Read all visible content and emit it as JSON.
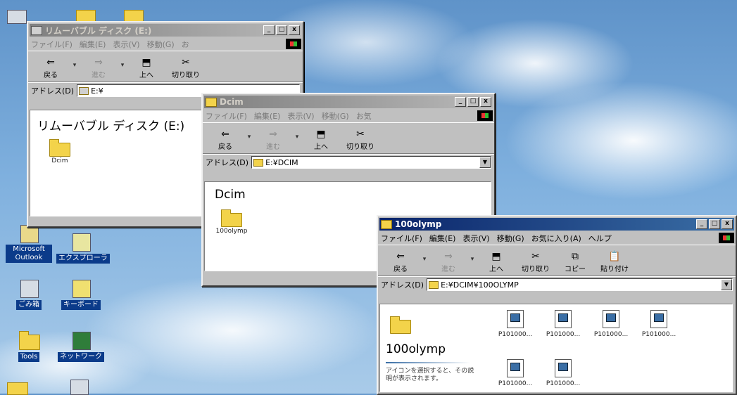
{
  "desktop": {
    "icons": [
      {
        "label": "Microsoft Outlook"
      },
      {
        "label": "エクスプローラ"
      },
      {
        "label": "ごみ箱"
      },
      {
        "label": "キーボード"
      },
      {
        "label": "Tools"
      },
      {
        "label": "ネットワーク"
      }
    ]
  },
  "windows": {
    "removable": {
      "title": "リムーバブル ディスク (E:)",
      "menu": [
        "ファイル(F)",
        "編集(E)",
        "表示(V)",
        "移動(G)",
        "お"
      ],
      "toolbar": {
        "back": "戻る",
        "forward": "進む",
        "up": "上へ",
        "cut": "切り取り"
      },
      "address_label": "アドレス(D)",
      "address_value": "E:¥",
      "header": "リムーバブル ディスク (E:)",
      "items": [
        {
          "name": "Dcim"
        }
      ]
    },
    "dcim": {
      "title": "Dcim",
      "menu": [
        "ファイル(F)",
        "編集(E)",
        "表示(V)",
        "移動(G)",
        "お気"
      ],
      "toolbar": {
        "back": "戻る",
        "forward": "進む",
        "up": "上へ",
        "cut": "切り取り"
      },
      "address_label": "アドレス(D)",
      "address_value": "E:¥DCIM",
      "header": "Dcim",
      "items": [
        {
          "name": "100olymp"
        }
      ]
    },
    "olymp": {
      "title": "100olymp",
      "menu": [
        "ファイル(F)",
        "編集(E)",
        "表示(V)",
        "移動(G)",
        "お気に入り(A)",
        "ヘルプ"
      ],
      "toolbar": {
        "back": "戻る",
        "forward": "進む",
        "up": "上へ",
        "cut": "切り取り",
        "copy": "コピー",
        "paste": "貼り付け"
      },
      "address_label": "アドレス(D)",
      "address_value": "E:¥DCIM¥100OLYMP",
      "header": "100olymp",
      "info_text": "アイコンを選択すると、その説明が表示されます。",
      "files": [
        {
          "name": "P101000..."
        },
        {
          "name": "P101000..."
        },
        {
          "name": "P101000..."
        },
        {
          "name": "P101000..."
        },
        {
          "name": "P101000..."
        },
        {
          "name": "P101000..."
        }
      ]
    }
  },
  "caption_buttons": {
    "minimize": "_",
    "maximize": "□",
    "close": "x"
  }
}
